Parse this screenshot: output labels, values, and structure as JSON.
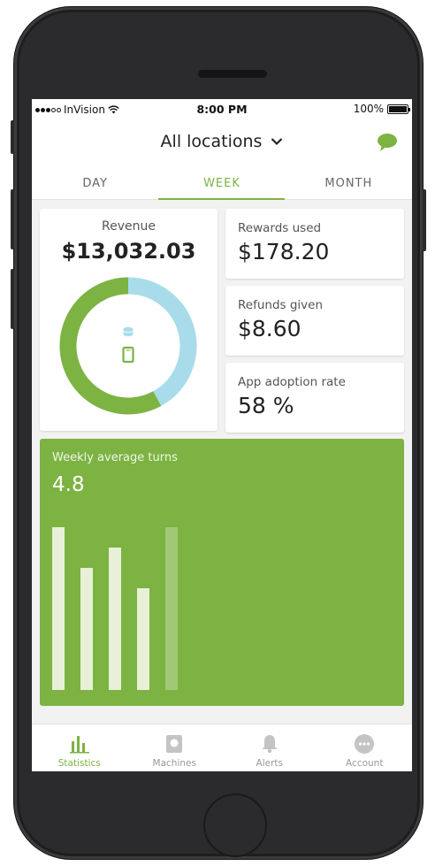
{
  "status_bar": {
    "carrier": "InVision",
    "time": "8:00 PM",
    "battery": "100%"
  },
  "header": {
    "title": "All locations",
    "chat_icon": "chat-bubble-icon",
    "accent_color": "#7cb342"
  },
  "tabs": [
    {
      "label": "DAY",
      "active": false
    },
    {
      "label": "WEEK",
      "active": true
    },
    {
      "label": "MONTH",
      "active": false
    }
  ],
  "revenue": {
    "label": "Revenue",
    "value": "$13,032.03",
    "donut": {
      "segments": [
        {
          "name": "machine",
          "fraction": 0.58,
          "color": "#7cb342"
        },
        {
          "name": "app",
          "fraction": 0.42,
          "color": "#a8dceb"
        }
      ],
      "icons": [
        "coins-icon",
        "phone-icon"
      ]
    }
  },
  "stats": [
    {
      "label": "Rewards used",
      "value": "$178.20"
    },
    {
      "label": "Refunds given",
      "value": "$8.60"
    },
    {
      "label": "App adoption rate",
      "value": "58 %"
    }
  ],
  "turns": {
    "label": "Weekly average turns",
    "value": "4.8"
  },
  "chart_data": {
    "type": "bar",
    "categories": [
      "",
      "",
      "",
      "",
      ""
    ],
    "values": [
      1.0,
      0.75,
      0.875,
      0.625,
      1.0
    ],
    "highlight_last": true,
    "title": "",
    "xlabel": "",
    "ylabel": ""
  },
  "bottom_nav": [
    {
      "label": "Statistics",
      "icon": "bar-chart-icon",
      "active": true
    },
    {
      "label": "Machines",
      "icon": "machine-icon",
      "active": false
    },
    {
      "label": "Alerts",
      "icon": "bell-icon",
      "active": false
    },
    {
      "label": "Account",
      "icon": "more-icon",
      "active": false
    }
  ]
}
